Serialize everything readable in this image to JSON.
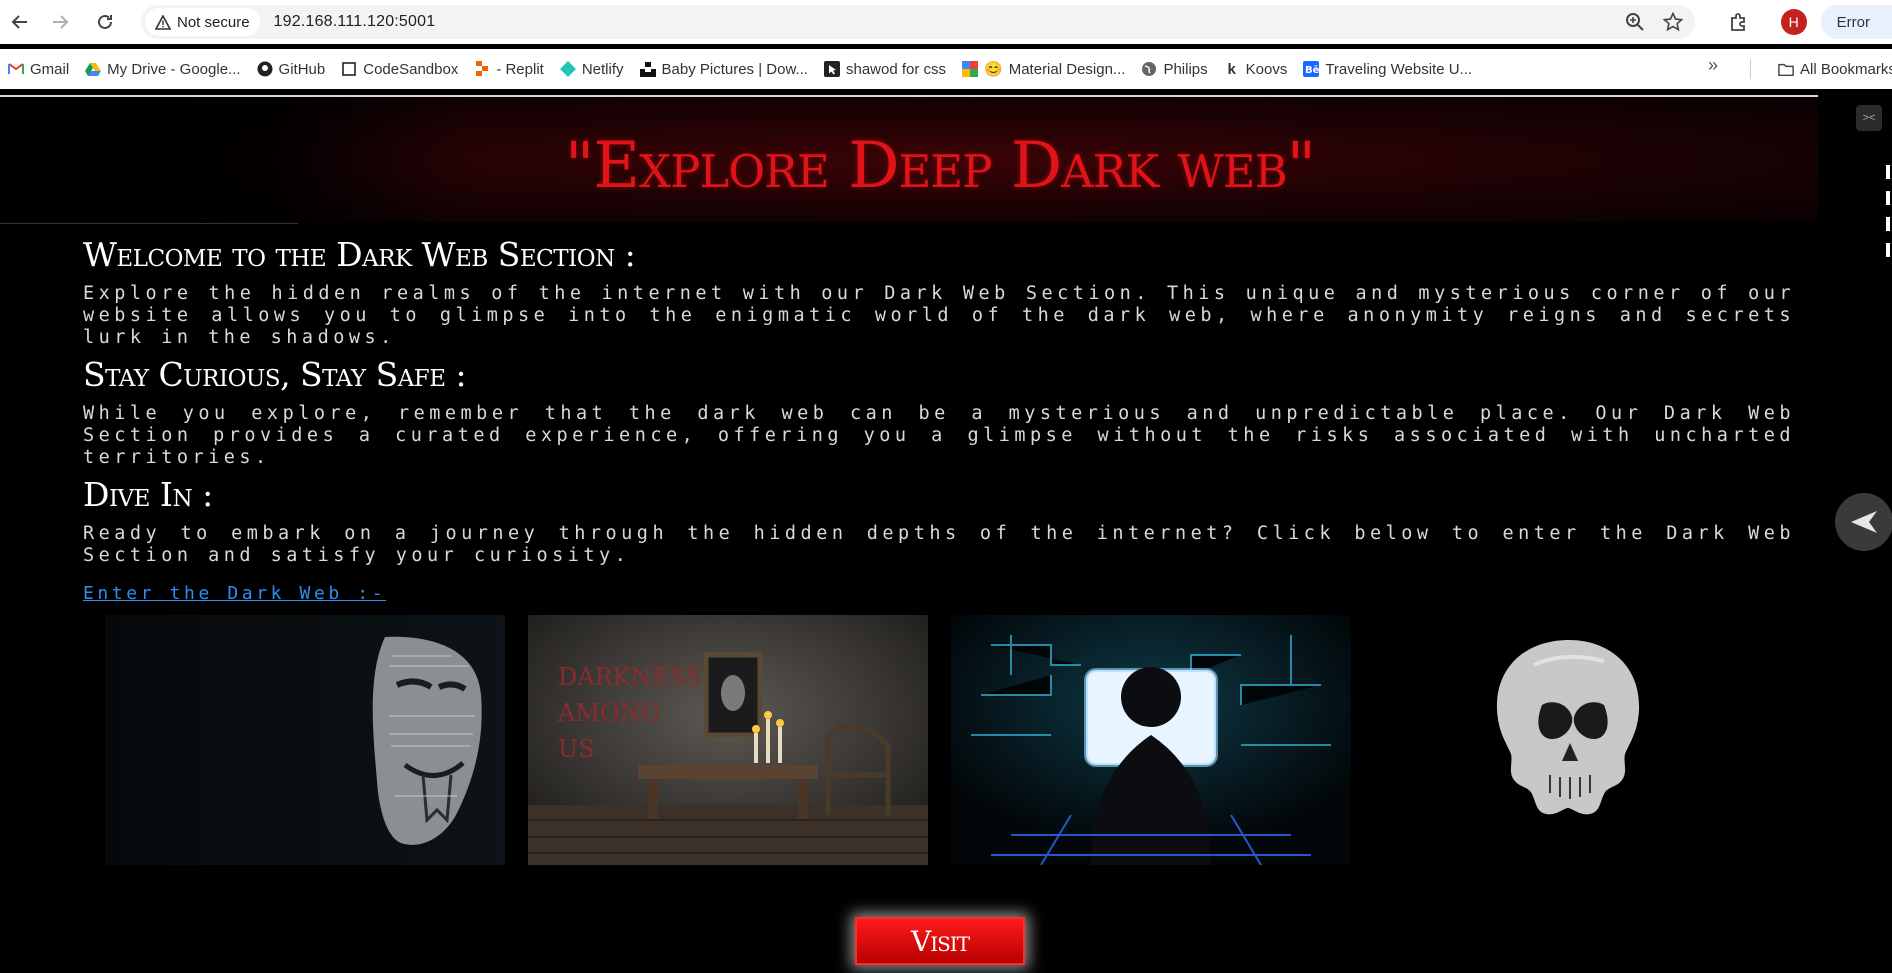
{
  "browser": {
    "security_label": "Not secure",
    "url": "192.168.111.120:5001",
    "profile_initial": "H",
    "error_label": "Error",
    "bookmarks": [
      {
        "label": "Gmail",
        "icon": "gmail-icon"
      },
      {
        "label": "My Drive - Google...",
        "icon": "drive-icon"
      },
      {
        "label": "GitHub",
        "icon": "github-icon"
      },
      {
        "label": "CodeSandbox",
        "icon": "codesandbox-icon"
      },
      {
        "label": "- Replit",
        "icon": "replit-icon"
      },
      {
        "label": "Netlify",
        "icon": "netlify-icon"
      },
      {
        "label": "Baby Pictures | Dow...",
        "icon": "unsplash-icon"
      },
      {
        "label": "shawod for css",
        "icon": "cursor-icon"
      },
      {
        "label": "Material Design...",
        "icon": "material-icon"
      },
      {
        "label": "Philips",
        "icon": "globe-icon"
      },
      {
        "label": "Koovs",
        "icon": "koovs-icon"
      },
      {
        "label": "Traveling Website U...",
        "icon": "behance-icon"
      }
    ],
    "all_bookmarks_label": "All Bookmarks"
  },
  "page": {
    "hero_title": "\"Explore Deep Dark web\"",
    "sections": [
      {
        "heading": "Welcome to the Dark Web Section :",
        "body": "Explore the hidden realms of the internet with our Dark Web Section. This unique and mysterious corner of our website allows you to glimpse into the enigmatic world of the dark web, where anonymity reigns and secrets lurk in the shadows."
      },
      {
        "heading": "Stay Curious, Stay Safe :",
        "body": "While you explore, remember that the dark web can be a mysterious and unpredictable place. Our Dark Web Section provides a curated experience, offering you a glimpse without the risks associated with uncharted territories."
      },
      {
        "heading": "Dive In :",
        "body": "Ready to embark on a journey through the hidden depths of the internet? Click below to enter the Dark Web Section and satisfy your curiosity."
      }
    ],
    "enter_link": "Enter the Dark Web :-",
    "gallery_text": {
      "room_sign_1": "DARKNESS",
      "room_sign_2": "AMONG",
      "room_sign_3": "US"
    },
    "visit_label": "Visit",
    "colors": {
      "accent_red": "#e01418",
      "link_blue": "#2f8cf0",
      "background": "#000000"
    }
  }
}
